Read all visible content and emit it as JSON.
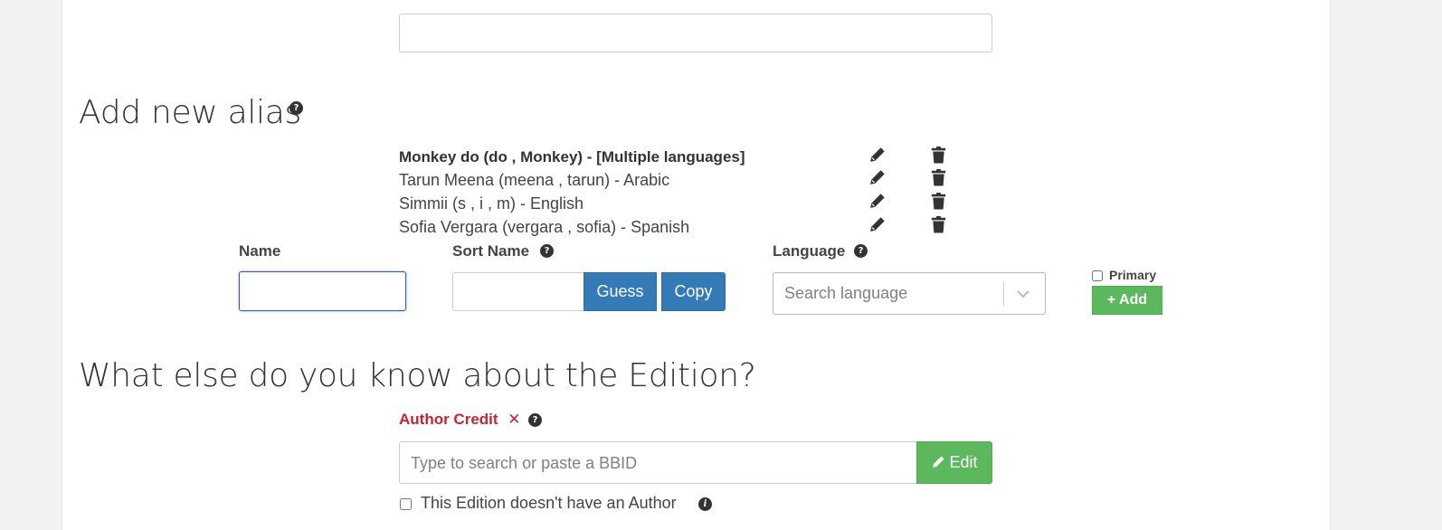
{
  "top_field": {
    "value": ""
  },
  "alias_section": {
    "heading": "Add new alias",
    "help_glyph": "?",
    "aliases": [
      {
        "text": "Monkey do (do , Monkey) - [Multiple languages]",
        "primary": true
      },
      {
        "text": "Tarun Meena (meena , tarun) - Arabic",
        "primary": false
      },
      {
        "text": "Simmii (s , i , m) - English",
        "primary": false
      },
      {
        "text": "Sofia Vergara (vergara , sofia) - Spanish",
        "primary": false
      }
    ],
    "name_label": "Name",
    "name_value": "",
    "sort_name_label": "Sort Name",
    "sort_name_value": "",
    "guess_label": "Guess",
    "copy_label": "Copy",
    "language_label": "Language",
    "language_placeholder": "Search language",
    "primary_label": "Primary",
    "add_label": "+ Add"
  },
  "edition_section": {
    "heading": "What else do you know about the Edition?",
    "author_credit_label": "Author Credit",
    "required_mark": "✕",
    "author_placeholder": "Type to search or paste a BBID",
    "edit_label": "Edit",
    "no_author_label": "This Edition doesn't have an Author",
    "info_glyph": "i"
  },
  "colors": {
    "required_red": "#c7252d",
    "primary_blue": "#337ab7",
    "success_green": "#5cb85c",
    "focus_border": "#2f5fb8"
  },
  "icons": {
    "edit": "pencil-icon",
    "delete": "trash-icon",
    "help": "question-circle-icon",
    "dropdown": "chevron-down-icon",
    "info": "info-circle-icon"
  }
}
